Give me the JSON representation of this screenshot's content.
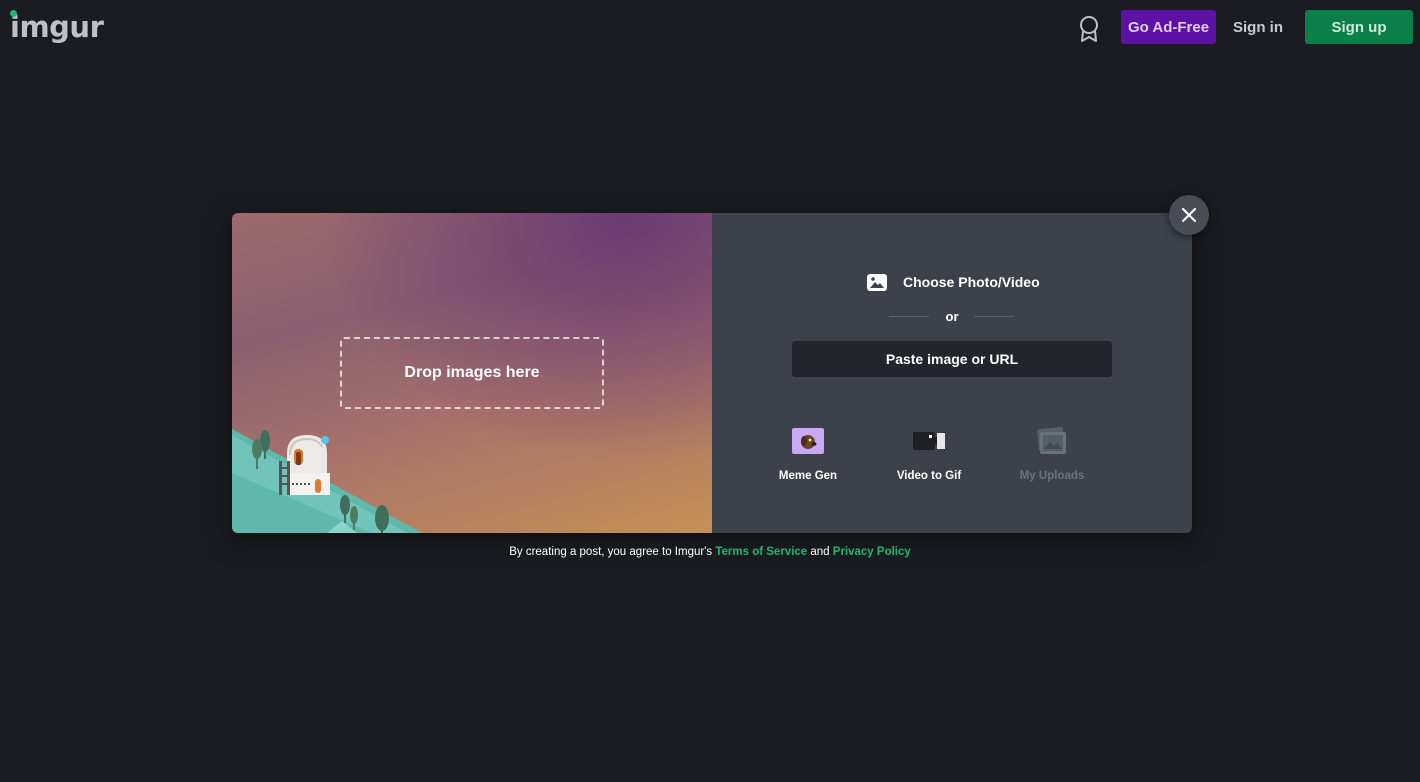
{
  "header": {
    "logo": "imgur",
    "go_ad_free": "Go Ad-Free",
    "sign_in": "Sign in",
    "sign_up": "Sign up"
  },
  "upload": {
    "drop_label": "Drop images here",
    "choose_label": "Choose Photo/Video",
    "or_label": "or",
    "paste_label": "Paste image or URL",
    "tools": [
      {
        "label": "Meme Gen",
        "icon": "meme-gen-icon"
      },
      {
        "label": "Video to Gif",
        "icon": "video-camera-icon"
      },
      {
        "label": "My Uploads",
        "icon": "photos-stack-icon"
      }
    ]
  },
  "footer": {
    "prefix": "By creating a post, you agree to Imgur's",
    "terms": "Terms of Service",
    "and": "and",
    "privacy": "Privacy Policy"
  },
  "colors": {
    "background": "#1b1c21",
    "ad_free": "#5c12a5",
    "sign_up": "#0b7f48",
    "link_green": "#1bb76e",
    "panel": "#3c414b"
  }
}
